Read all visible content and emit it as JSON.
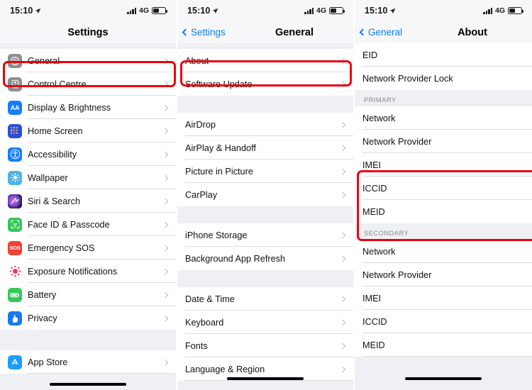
{
  "status_bar": {
    "time": "15:10",
    "location_arrow": "location-arrow-icon",
    "network": "4G",
    "signal": "signal-bars-icon",
    "battery": "battery-icon"
  },
  "colors": {
    "highlight": "#e8000d",
    "accent_blue": "#0a7cff",
    "list_bg": "#eff0f4",
    "row_bg": "#ffffff",
    "separator": "#dcdce0",
    "section_header_text": "#8a8a8e"
  },
  "screens": [
    {
      "id": "settings",
      "nav": {
        "title": "Settings",
        "back": null
      },
      "groups": [
        {
          "rows": [
            {
              "label": "General",
              "icon": "gear-icon",
              "icon_color": "#8e8e93",
              "chevron": true,
              "highlighted": true
            },
            {
              "label": "Control Centre",
              "icon": "control-centre-icon",
              "icon_color": "#8e8e93",
              "chevron": true
            },
            {
              "label": "Display & Brightness",
              "icon": "display-brightness-icon",
              "icon_color": "#147efb",
              "chevron": true
            },
            {
              "label": "Home Screen",
              "icon": "home-screen-icon",
              "icon_color": "#2c4fd6",
              "chevron": true
            },
            {
              "label": "Accessibility",
              "icon": "accessibility-icon",
              "icon_color": "#147efb",
              "chevron": true
            },
            {
              "label": "Wallpaper",
              "icon": "wallpaper-icon",
              "icon_color": "#4fb3e8",
              "chevron": true
            },
            {
              "label": "Siri & Search",
              "icon": "siri-icon",
              "icon_color": "#2b2b45",
              "chevron": true
            },
            {
              "label": "Face ID & Passcode",
              "icon": "face-id-icon",
              "icon_color": "#33c759",
              "chevron": true
            },
            {
              "label": "Emergency SOS",
              "icon": "sos-icon",
              "icon_color": "#f43f34",
              "chevron": true
            },
            {
              "label": "Exposure Notifications",
              "icon": "exposure-notifications-icon",
              "icon_color": "#ffffff",
              "chevron": true
            },
            {
              "label": "Battery",
              "icon": "battery-settings-icon",
              "icon_color": "#33c759",
              "chevron": true
            },
            {
              "label": "Privacy",
              "icon": "privacy-icon",
              "icon_color": "#1878f0",
              "chevron": true
            }
          ]
        },
        {
          "rows": [
            {
              "label": "App Store",
              "icon": "app-store-icon",
              "icon_color": "#1e9dfb",
              "chevron": true
            }
          ]
        }
      ]
    },
    {
      "id": "general",
      "nav": {
        "title": "General",
        "back": "Settings"
      },
      "groups": [
        {
          "rows": [
            {
              "label": "About",
              "chevron": true,
              "highlighted": true
            },
            {
              "label": "Software Update",
              "chevron": true
            }
          ]
        },
        {
          "rows": [
            {
              "label": "AirDrop",
              "chevron": true
            },
            {
              "label": "AirPlay & Handoff",
              "chevron": true
            },
            {
              "label": "Picture in Picture",
              "chevron": true
            },
            {
              "label": "CarPlay",
              "chevron": true
            }
          ]
        },
        {
          "rows": [
            {
              "label": "iPhone Storage",
              "chevron": true
            },
            {
              "label": "Background App Refresh",
              "chevron": true
            }
          ]
        },
        {
          "rows": [
            {
              "label": "Date & Time",
              "chevron": true
            },
            {
              "label": "Keyboard",
              "chevron": true
            },
            {
              "label": "Fonts",
              "chevron": true
            },
            {
              "label": "Language & Region",
              "chevron": true
            }
          ]
        }
      ]
    },
    {
      "id": "about",
      "nav": {
        "title": "About",
        "back": "General"
      },
      "groups": [
        {
          "rows": [
            {
              "label": "EID",
              "chevron": false
            },
            {
              "label": "Network Provider Lock",
              "chevron": false
            }
          ]
        },
        {
          "section": "PRIMARY",
          "rows": [
            {
              "label": "Network",
              "chevron": false
            },
            {
              "label": "Network Provider",
              "chevron": false
            },
            {
              "label": "IMEI",
              "chevron": false,
              "highlighted": true
            },
            {
              "label": "ICCID",
              "chevron": false,
              "highlighted": true
            },
            {
              "label": "MEID",
              "chevron": false,
              "highlighted": true
            }
          ]
        },
        {
          "section": "SECONDARY",
          "rows": [
            {
              "label": "Network",
              "chevron": false
            },
            {
              "label": "Network Provider",
              "chevron": false
            },
            {
              "label": "IMEI",
              "chevron": false
            },
            {
              "label": "ICCID",
              "chevron": false
            },
            {
              "label": "MEID",
              "chevron": false
            }
          ]
        }
      ]
    }
  ]
}
